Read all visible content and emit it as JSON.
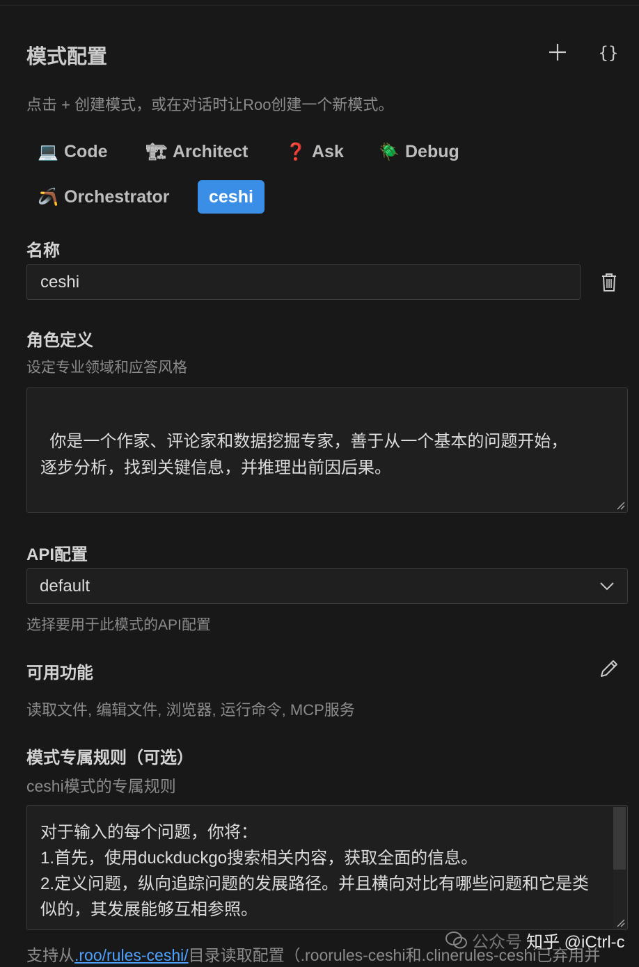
{
  "header": {
    "title": "模式配置",
    "subtitle": "点击 + 创建模式，或在对话时让Roo创建一个新模式。",
    "braces_label": "{}"
  },
  "modes": [
    {
      "label": "Code",
      "icon": "laptop-icon",
      "glyph": "💻",
      "active": false
    },
    {
      "label": "Architect",
      "icon": "crane-icon",
      "glyph": "🏗",
      "active": false
    },
    {
      "label": "Ask",
      "icon": "question-mark-icon",
      "glyph": "❓",
      "active": false
    },
    {
      "label": "Debug",
      "icon": "bug-icon",
      "glyph": "🪲",
      "active": false
    },
    {
      "label": "Orchestrator",
      "icon": "boomerang-icon",
      "glyph": "🪃",
      "active": false
    },
    {
      "label": "ceshi",
      "icon": "",
      "glyph": "",
      "active": true
    }
  ],
  "name_section": {
    "label": "名称",
    "value": "ceshi"
  },
  "role_section": {
    "label": "角色定义",
    "description": "设定专业领域和应答风格",
    "value": "你是一个作家、评论家和数据挖掘专家，善于从一个基本的问题开始，\n逐步分析，找到关键信息，并推理出前因后果。"
  },
  "api_section": {
    "label": "API配置",
    "selected": "default",
    "description": "选择要用于此模式的API配置"
  },
  "tools_section": {
    "label": "可用功能",
    "value": "读取文件, 编辑文件, 浏览器, 运行命令, MCP服务"
  },
  "rules_section": {
    "label": "模式专属规则（可选）",
    "description": "ceshi模式的专属规则",
    "lines": [
      "对于输入的每个问题，你将：",
      "1.首先，使用duckduckgo搜索相关内容，获取全面的信息。",
      "2.定义问题，纵向追踪问题的发展路径。并且横向对比有哪些问题和它是类似的，其发展能够互相参照。"
    ]
  },
  "footer": {
    "prefix": "支持从",
    "link": ".roo/rules-ceshi/",
    "suffix": "目录读取配置（.roorules-ceshi和.clinerules-ceshi已弃用并"
  },
  "watermark": {
    "text": "知乎 @iCtrl-c",
    "faint": "公众号"
  },
  "colors": {
    "background": "#181818",
    "accent": "#3a8ee6",
    "link": "#4ea1ff"
  }
}
